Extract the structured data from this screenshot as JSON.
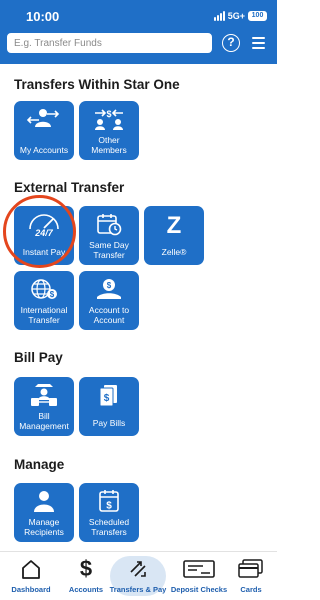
{
  "status_bar": {
    "time": "10:00",
    "network": "5G+",
    "battery": "100"
  },
  "header": {
    "search_placeholder": "E.g. Transfer Funds",
    "help_icon": "?"
  },
  "sections": {
    "within": {
      "title": "Transfers Within Star One",
      "tiles": [
        {
          "label": "My Accounts",
          "icon": "user-transfer-icon"
        },
        {
          "label": "Other Members",
          "icon": "money-transfer-icon"
        }
      ]
    },
    "external": {
      "title": "External Transfer",
      "tiles": [
        {
          "label": "Instant Pay",
          "icon": "speedometer-24-7-icon",
          "icon_text": "24/7"
        },
        {
          "label": "Same Day Transfer",
          "icon": "calendar-clock-icon"
        },
        {
          "label": "Zelle®",
          "icon": "zelle-icon",
          "icon_text": "Z"
        },
        {
          "label": "International Transfer",
          "icon": "globe-dollar-icon"
        },
        {
          "label": "Account to Account",
          "icon": "bank-transfer-icon"
        }
      ]
    },
    "bill_pay": {
      "title": "Bill Pay",
      "tiles": [
        {
          "label": "Bill Management",
          "icon": "user-bills-icon"
        },
        {
          "label": "Pay Bills",
          "icon": "bills-dollar-icon"
        }
      ]
    },
    "manage": {
      "title": "Manage",
      "tiles": [
        {
          "label": "Manage Recipients",
          "icon": "user-recipients-icon"
        },
        {
          "label": "Scheduled Transfers",
          "icon": "calendar-dollar-icon"
        }
      ]
    }
  },
  "bottom_nav": {
    "items": [
      {
        "label": "Dashboard",
        "icon": "home-icon"
      },
      {
        "label": "Accounts",
        "icon": "dollar-icon"
      },
      {
        "label": "Transfers & Pay",
        "icon": "transfer-arrows-icon",
        "active": true
      },
      {
        "label": "Deposit Checks",
        "icon": "check-icon"
      },
      {
        "label": "Cards",
        "icon": "cards-icon"
      }
    ]
  },
  "colors": {
    "primary": "#1f6fc7",
    "highlight_ring": "#e4461d",
    "nav_active_bg": "#d9e6f4",
    "nav_text": "#1f5fae"
  }
}
